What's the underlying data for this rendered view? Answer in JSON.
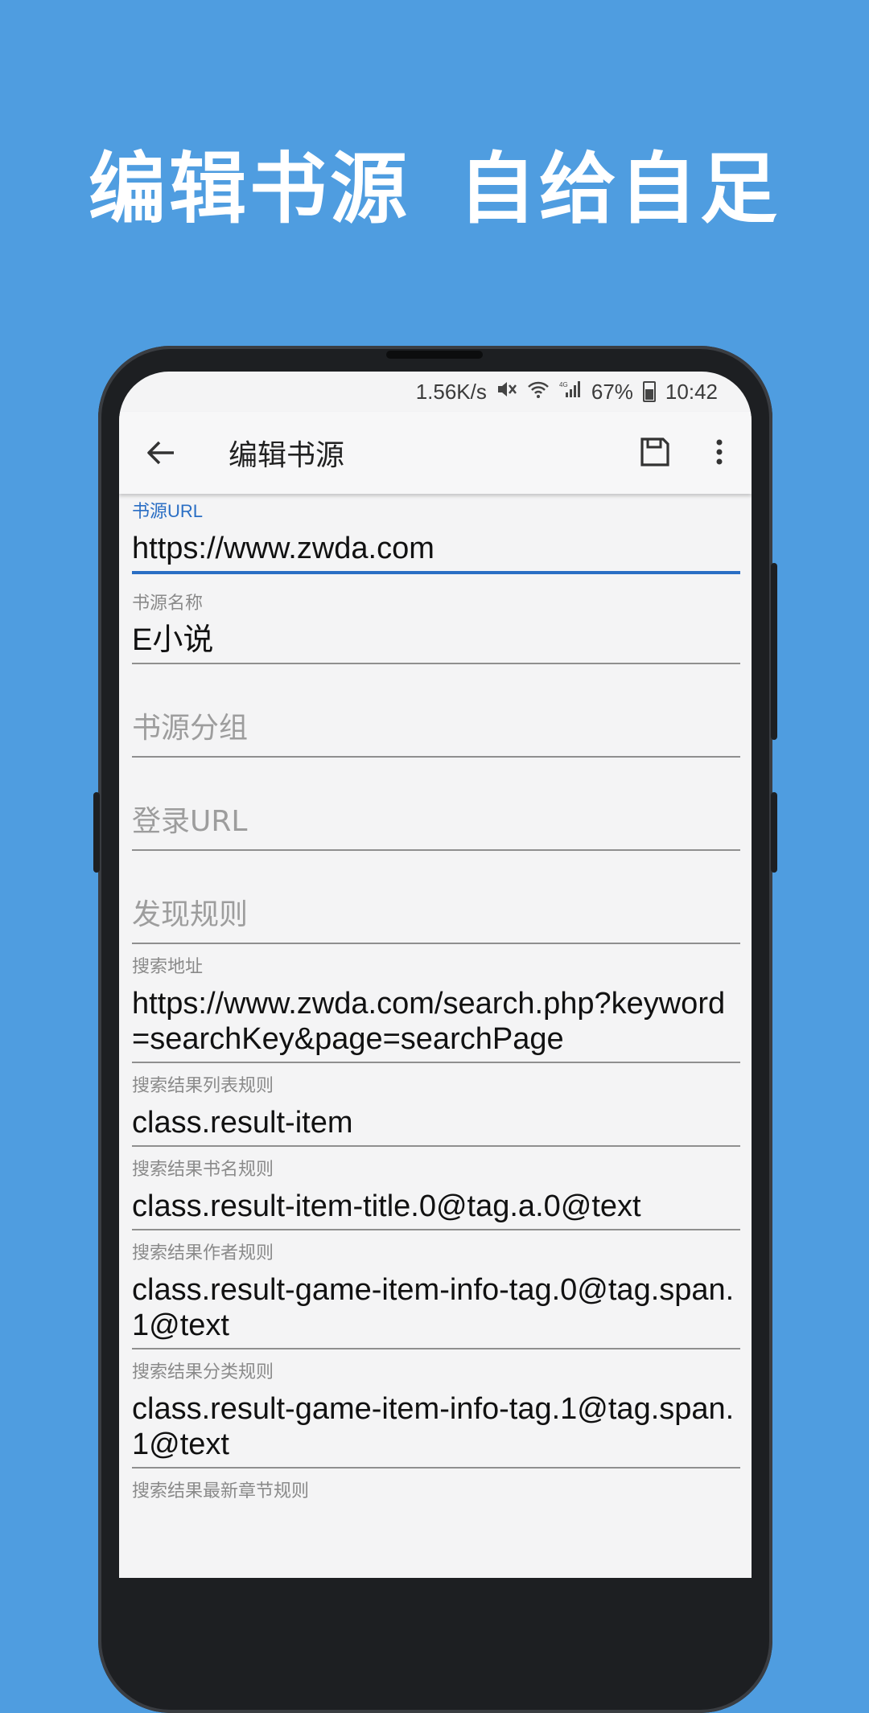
{
  "banner": {
    "left": "编辑书源",
    "right": "自给自足"
  },
  "status_bar": {
    "speed": "1.56K/s",
    "battery": "67%",
    "time": "10:42",
    "icons": [
      "mute-icon",
      "wifi-icon",
      "4g-signal-icon",
      "battery-icon"
    ]
  },
  "toolbar": {
    "title": "编辑书源",
    "back_icon": "arrow-left-icon",
    "save_icon": "save-icon",
    "more_icon": "more-vert-icon"
  },
  "colors": {
    "background": "#4f9de0",
    "accent": "#2a6ec4",
    "screen": "#f4f4f5"
  },
  "fields": [
    {
      "label": "书源URL",
      "value": "https://www.zwda.com",
      "placeholder": "",
      "focused": true
    },
    {
      "label": "书源名称",
      "value": "E小说",
      "placeholder": "",
      "focused": false
    },
    {
      "label": "",
      "value": "",
      "placeholder": "书源分组",
      "focused": false
    },
    {
      "label": "",
      "value": "",
      "placeholder": "登录URL",
      "focused": false
    },
    {
      "label": "",
      "value": "",
      "placeholder": "发现规则",
      "focused": false
    },
    {
      "label": "搜索地址",
      "value": "https://www.zwda.com/search.php?keyword=searchKey&page=searchPage",
      "placeholder": "",
      "focused": false
    },
    {
      "label": "搜索结果列表规则",
      "value": "class.result-item",
      "placeholder": "",
      "focused": false
    },
    {
      "label": "搜索结果书名规则",
      "value": "class.result-item-title.0@tag.a.0@text",
      "placeholder": "",
      "focused": false
    },
    {
      "label": "搜索结果作者规则",
      "value": "class.result-game-item-info-tag.0@tag.span.1@text",
      "placeholder": "",
      "focused": false
    },
    {
      "label": "搜索结果分类规则",
      "value": "class.result-game-item-info-tag.1@tag.span.1@text",
      "placeholder": "",
      "focused": false
    },
    {
      "label": "搜索结果最新章节规则",
      "value": "",
      "placeholder": "",
      "focused": false
    }
  ]
}
